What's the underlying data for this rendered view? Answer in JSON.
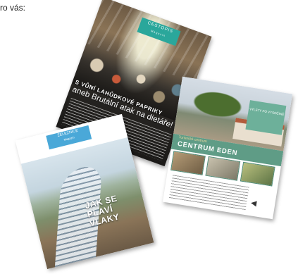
{
  "intro_text": "ro vás:",
  "magazines": [
    {
      "brand": "CESTOPIS",
      "brand_sub": "Magazin",
      "headline_1": "S VŮNÍ LAHŮDKOVÉ PAPRIKY",
      "headline_2": "aneb Brutální atak na dietáře!"
    },
    {
      "brand": "VÝLETY PO VYSOČINĚ",
      "kicker": "Turistické centrum",
      "title": "CENTRUM EDEN"
    },
    {
      "brand": "ŽELEZNICE",
      "brand_sub": "Magazín",
      "headline": "JAK SE PLAVÍ VLAKY"
    }
  ]
}
